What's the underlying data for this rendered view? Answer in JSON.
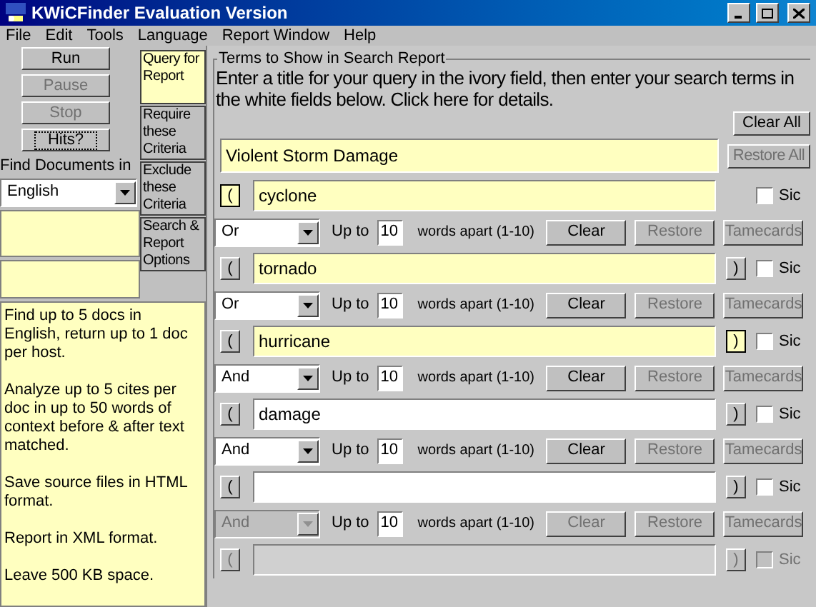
{
  "window": {
    "title": "KWiCFinder Evaluation Version"
  },
  "menu": [
    "File",
    "Edit",
    "Tools",
    "Language",
    "Report Window",
    "Help"
  ],
  "actions": [
    {
      "label": "Run",
      "disabled": false,
      "focused": false
    },
    {
      "label": "Pause",
      "disabled": true,
      "focused": false
    },
    {
      "label": "Stop",
      "disabled": true,
      "focused": false
    },
    {
      "label": "Hits?",
      "disabled": false,
      "focused": true
    }
  ],
  "find_documents": {
    "label": "Find Documents in",
    "language": "English"
  },
  "summary": [
    "Find up to 5 docs in English, return up to 1 doc per host.",
    "Analyze up to 5 cites per doc in up to 50 words of context before & after text matched.",
    "Save source files in HTML format.",
    "Report in XML format.",
    "Leave 500 KB space."
  ],
  "tabs": [
    {
      "label": "Query for Report",
      "selected": true
    },
    {
      "label": "Require these Criteria",
      "selected": false
    },
    {
      "label": "Exclude these Criteria",
      "selected": false
    },
    {
      "label": "Search & Report Options",
      "selected": false
    }
  ],
  "group": {
    "title": "Terms to Show in Search Report",
    "instructions": "Enter a title for your query in the ivory field, then enter your search terms in the white fields below. Click here for details.",
    "clear_all": "Clear All",
    "restore_all": {
      "label": "Restore All",
      "disabled": true
    },
    "query_title": "Violent Storm Damage"
  },
  "terms": [
    {
      "open": {
        "label": "(",
        "highlighted": true
      },
      "value": "cyclone",
      "ivory": true,
      "disabled": false,
      "sic": {
        "label": "Sic",
        "checked": false
      },
      "connector": {
        "operator": "Or",
        "up_to": "Up to",
        "distance": "10",
        "apart": "words apart (1-10)",
        "disabled": false,
        "buttons": [
          {
            "label": "Clear",
            "disabled": false
          },
          {
            "label": "Restore",
            "disabled": true
          },
          {
            "label": "Tamecards",
            "disabled": true
          }
        ]
      }
    },
    {
      "open": {
        "label": "(",
        "highlighted": false
      },
      "value": "tornado",
      "ivory": true,
      "disabled": false,
      "close": {
        "label": ")",
        "highlighted": false
      },
      "sic": {
        "label": "Sic",
        "checked": false
      },
      "connector": {
        "operator": "Or",
        "up_to": "Up to",
        "distance": "10",
        "apart": "words apart (1-10)",
        "disabled": false,
        "buttons": [
          {
            "label": "Clear",
            "disabled": false
          },
          {
            "label": "Restore",
            "disabled": true
          },
          {
            "label": "Tamecards",
            "disabled": true
          }
        ]
      }
    },
    {
      "open": {
        "label": "(",
        "highlighted": false
      },
      "value": "hurricane",
      "ivory": true,
      "disabled": false,
      "close": {
        "label": ")",
        "highlighted": true
      },
      "sic": {
        "label": "Sic",
        "checked": false
      },
      "connector": {
        "operator": "And",
        "up_to": "Up to",
        "distance": "10",
        "apart": "words apart (1-10)",
        "disabled": false,
        "buttons": [
          {
            "label": "Clear",
            "disabled": false
          },
          {
            "label": "Restore",
            "disabled": true
          },
          {
            "label": "Tamecards",
            "disabled": true
          }
        ]
      }
    },
    {
      "open": {
        "label": "(",
        "highlighted": false
      },
      "value": "damage",
      "ivory": false,
      "disabled": false,
      "close": {
        "label": ")",
        "highlighted": false
      },
      "sic": {
        "label": "Sic",
        "checked": false
      },
      "connector": {
        "operator": "And",
        "up_to": "Up to",
        "distance": "10",
        "apart": "words apart (1-10)",
        "disabled": false,
        "buttons": [
          {
            "label": "Clear",
            "disabled": false
          },
          {
            "label": "Restore",
            "disabled": true
          },
          {
            "label": "Tamecards",
            "disabled": true
          }
        ]
      }
    },
    {
      "open": {
        "label": "(",
        "highlighted": false
      },
      "ivory": false,
      "disabled": false,
      "close": {
        "label": ")",
        "highlighted": false
      },
      "sic": {
        "label": "Sic",
        "checked": false
      },
      "connector": {
        "operator": "And",
        "up_to": "Up to",
        "distance": "10",
        "apart": "words apart (1-10)",
        "disabled": true,
        "buttons": [
          {
            "label": "Clear",
            "disabled": true
          },
          {
            "label": "Restore",
            "disabled": true
          },
          {
            "label": "Tamecards",
            "disabled": true
          }
        ]
      }
    },
    {
      "open": {
        "label": "(",
        "highlighted": false
      },
      "disabled": true,
      "close": {
        "label": ")",
        "highlighted": false
      },
      "sic": {
        "label": "Sic",
        "checked": false
      }
    }
  ]
}
